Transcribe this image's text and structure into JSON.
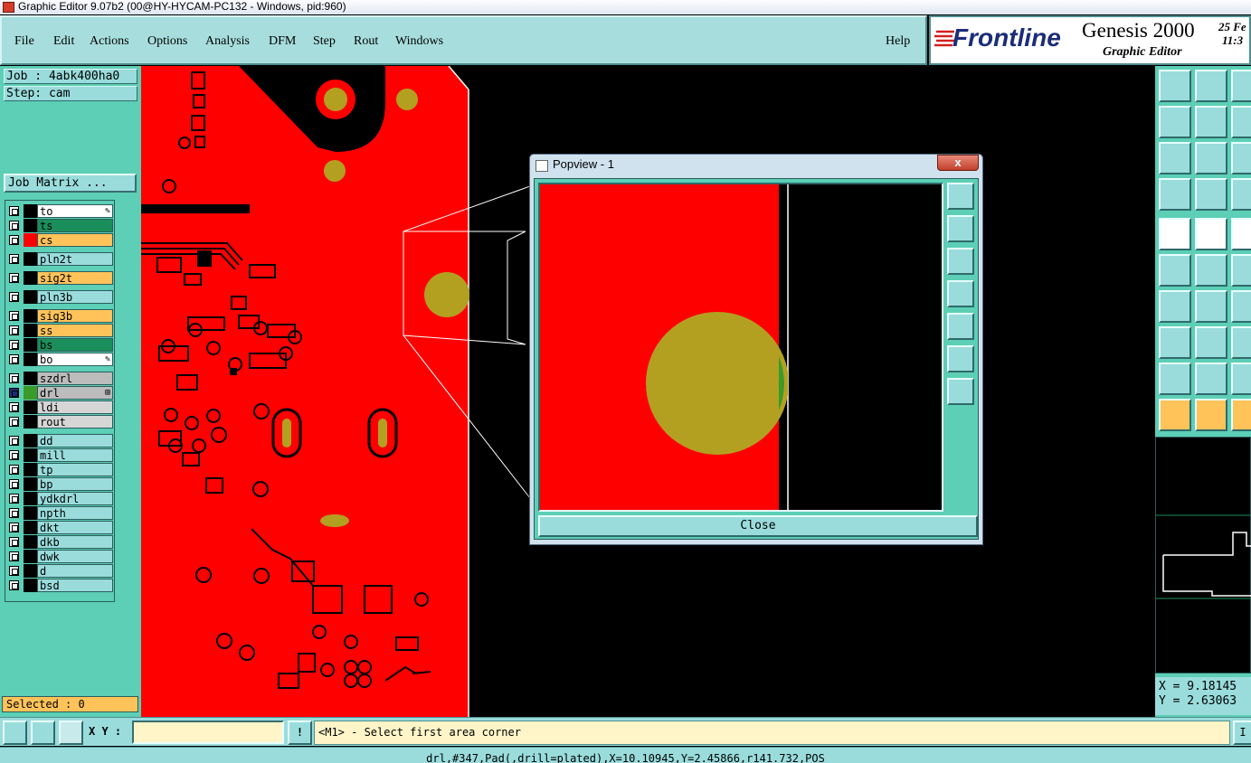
{
  "window": {
    "title": "Graphic Editor 9.07b2 (00@HY-HYCAM-PC132 - Windows, pid:960)"
  },
  "menu": {
    "items": [
      "File",
      "Edit",
      "Actions",
      "Options",
      "Analysis",
      "DFM",
      "Step",
      "Rout",
      "Windows"
    ],
    "help": "Help"
  },
  "brand": {
    "logo": "Frontline",
    "product": "Genesis 2000",
    "subtitle": "Graphic Editor",
    "date": "25 Fe",
    "time": "11:3"
  },
  "job": {
    "job_label": "Job : 4abk400ha0",
    "step_label": "Step: cam",
    "matrix_button": "Job Matrix ..."
  },
  "layers": [
    {
      "name": "to",
      "color": "#ffffff",
      "swatch": "#000000",
      "mark": "✎"
    },
    {
      "name": "ts",
      "color": "#1a8f5c",
      "swatch": "#000000",
      "mark": ""
    },
    {
      "name": "cs",
      "color": "#ffc35a",
      "swatch": "#ff0000",
      "mark": ""
    },
    {
      "name": "pln2t",
      "color": "#9adcdc",
      "swatch": "#000000",
      "mark": ""
    },
    {
      "name": "sig2t",
      "color": "#ffc35a",
      "swatch": "#000000",
      "mark": ""
    },
    {
      "name": "pln3b",
      "color": "#9adcdc",
      "swatch": "#000000",
      "mark": ""
    },
    {
      "name": "sig3b",
      "color": "#ffc35a",
      "swatch": "#000000",
      "mark": ""
    },
    {
      "name": "ss",
      "color": "#ffc35a",
      "swatch": "#000000",
      "mark": ""
    },
    {
      "name": "bs",
      "color": "#1a8f5c",
      "swatch": "#000000",
      "mark": ""
    },
    {
      "name": "bo",
      "color": "#ffffff",
      "swatch": "#000000",
      "mark": "✎"
    },
    {
      "name": "szdrl",
      "color": "#bcbcbc",
      "swatch": "#000000",
      "mark": ""
    },
    {
      "name": "drl",
      "color": "#bcbcbc",
      "swatch": "#3a9a2a",
      "mark": "⊞"
    },
    {
      "name": "ldi",
      "color": "#d6d6d6",
      "swatch": "#000000",
      "mark": ""
    },
    {
      "name": "rout",
      "color": "#d6d6d6",
      "swatch": "#000000",
      "mark": ""
    },
    {
      "name": "dd",
      "color": "#9adcdc",
      "swatch": "#000000",
      "mark": ""
    },
    {
      "name": "mill",
      "color": "#9adcdc",
      "swatch": "#000000",
      "mark": ""
    },
    {
      "name": "tp",
      "color": "#9adcdc",
      "swatch": "#000000",
      "mark": ""
    },
    {
      "name": "bp",
      "color": "#9adcdc",
      "swatch": "#000000",
      "mark": ""
    },
    {
      "name": "ydkdrl",
      "color": "#9adcdc",
      "swatch": "#000000",
      "mark": ""
    },
    {
      "name": "npth",
      "color": "#9adcdc",
      "swatch": "#000000",
      "mark": ""
    },
    {
      "name": "dkt",
      "color": "#9adcdc",
      "swatch": "#000000",
      "mark": ""
    },
    {
      "name": "dkb",
      "color": "#9adcdc",
      "swatch": "#000000",
      "mark": ""
    },
    {
      "name": "dwk",
      "color": "#9adcdc",
      "swatch": "#000000",
      "mark": ""
    },
    {
      "name": "d",
      "color": "#9adcdc",
      "swatch": "#000000",
      "mark": ""
    },
    {
      "name": "bsd",
      "color": "#9adcdc",
      "swatch": "#000000",
      "mark": ""
    }
  ],
  "selected": "Selected : 0",
  "coords": {
    "x": "X = 9.18145",
    "y": "Y = 2.63063"
  },
  "bottom": {
    "xy_label": "X Y :",
    "xy_value": "",
    "prompt": "<M1> - Select first area corner",
    "right_btn": "I"
  },
  "status": "drl,#347,Pad(,drill=plated),X=10.10945,Y=2.45866,r141.732,POS",
  "popview": {
    "title": "Popview - 1",
    "close_x": "x",
    "close_label": "Close"
  },
  "colors": {
    "copper": "#ff0000",
    "drill": "#b3a020",
    "outline": "#ffffff",
    "panel": "#5ccfb6"
  }
}
